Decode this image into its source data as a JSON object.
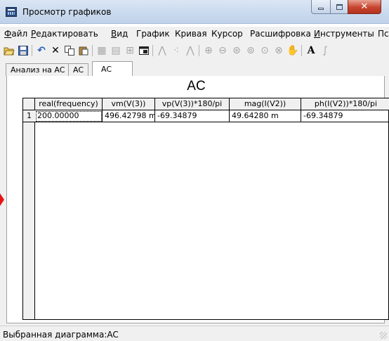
{
  "window": {
    "title": "Просмотр графиков"
  },
  "menu": {
    "items": [
      "Файл",
      "Редактировать",
      "Вид",
      "График",
      "Кривая",
      "Курсор",
      "Расшифровка",
      "Инструменты",
      "Пс"
    ],
    "underlined_initial": [
      true,
      true,
      true,
      false,
      false,
      false,
      false,
      true,
      false
    ]
  },
  "toolbar": {
    "icons": [
      "open-folder-icon",
      "save-icon",
      "undo-icon",
      "delete-icon",
      "copy-icon",
      "paste-icon",
      "grid-icon",
      "table-icon",
      "axes-icon",
      "window-icon",
      "line-plot-icon",
      "scatter-plot-icon",
      "line-marker-plot-icon",
      "zoom-in-icon",
      "zoom-out-icon",
      "zoom-fit-icon",
      "zoom-previous-icon",
      "zoom-region-icon",
      "zoom-x-icon",
      "pan-hand-icon",
      "text-annotation-icon",
      "formula-icon"
    ]
  },
  "tabs": [
    {
      "label": "Анализ на AC",
      "active": false
    },
    {
      "label": "AC",
      "active": false
    },
    {
      "label": "AC",
      "active": true
    }
  ],
  "table": {
    "title": "AC",
    "columns": [
      "real(frequency)",
      "vm(V(3))",
      "vp(V(3))*180/pi",
      "mag(I(V2))",
      "ph(I(V2))*180/pi"
    ],
    "rows": [
      {
        "num": "1",
        "cells": [
          "200.00000",
          "496.42798 m",
          "-69.34879",
          "49.64280 m",
          "-69.34879"
        ]
      }
    ]
  },
  "status": {
    "text": "Выбранная диаграмма:AC"
  },
  "colors": {
    "accent_marker": "#e81515",
    "titlebar": "#cddcef",
    "close_button": "#c7452f"
  }
}
